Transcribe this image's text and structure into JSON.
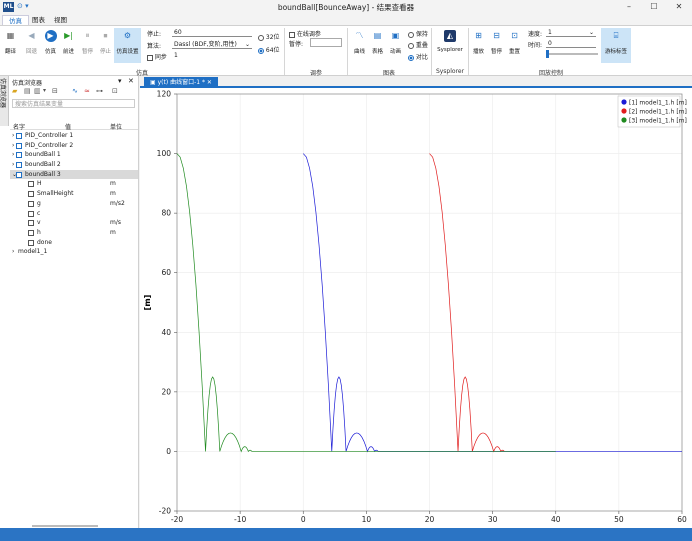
{
  "window": {
    "title": "boundBall[BounceAway] - 结果查看器",
    "app_icon": "ML",
    "quick_access": "⊙ ▾"
  },
  "menu": [
    "仿真",
    "图表",
    "视图"
  ],
  "ribbon": {
    "buttons_left": [
      {
        "label": "翻译",
        "icon": "translate-icon"
      },
      {
        "label": "回退",
        "icon": "step-back-icon"
      },
      {
        "label": "仿真",
        "icon": "play-icon"
      },
      {
        "label": "前进",
        "icon": "step-forward-icon"
      },
      {
        "label": "暂停",
        "icon": "pause-icon"
      },
      {
        "label": "停止",
        "icon": "stop-icon"
      },
      {
        "label": "仿真设置",
        "icon": "settings-icon"
      }
    ],
    "stop_label": "停止:",
    "stop_value": "60",
    "algo_label": "算法:",
    "algo_value": "Dassl (BDF,变阶,用性)",
    "sync_label": "同步",
    "sync_value": "1",
    "bit32": "32位",
    "bit64": "64位",
    "sim_group": "仿真",
    "online_label": "在线调参",
    "pause_label": "暂停:",
    "tune_group": "调参",
    "chart_buttons": [
      {
        "label": "曲线",
        "icon": "curve-icon"
      },
      {
        "label": "表格",
        "icon": "table-icon"
      },
      {
        "label": "动画",
        "icon": "animation-icon"
      }
    ],
    "keep": "保持",
    "overlay": "重叠",
    "compare": "对比",
    "chart_group": "图表",
    "sysplorer_label": "Sysplorer",
    "sysplorer_group": "Sysplorer",
    "play_buttons": [
      {
        "label": "播放",
        "icon": "play-record-icon"
      },
      {
        "label": "暂停",
        "icon": "pause-record-icon"
      },
      {
        "label": "重置",
        "icon": "reset-icon"
      }
    ],
    "speed_label": "速度:",
    "speed_value": "1",
    "time_label": "时间:",
    "time_value": "0",
    "cursor_button": "游标标签",
    "playback_group": "回放控制"
  },
  "browser": {
    "title": "仿真浏览器",
    "side_tab": "仿真浏览器",
    "search_placeholder": "搜索仿真结果变量",
    "columns": [
      "名字",
      "值",
      "单位"
    ],
    "rows": [
      {
        "name": "PID_Controller 1",
        "unit": "",
        "level": 0,
        "expander": "›"
      },
      {
        "name": "PID_Controller 2",
        "unit": "",
        "level": 0,
        "expander": "›"
      },
      {
        "name": "boundBall 1",
        "unit": "",
        "level": 0,
        "expander": "›"
      },
      {
        "name": "boundBall 2",
        "unit": "",
        "level": 0,
        "expander": "›"
      },
      {
        "name": "boundBall 3",
        "unit": "",
        "level": 0,
        "expander": "⌄",
        "selected": true
      },
      {
        "name": "H",
        "unit": "m",
        "level": 1
      },
      {
        "name": "SmallHeight",
        "unit": "m",
        "level": 1
      },
      {
        "name": "g",
        "unit": "m/s2",
        "level": 1
      },
      {
        "name": "c",
        "unit": "",
        "level": 1
      },
      {
        "name": "v",
        "unit": "m/s",
        "level": 1
      },
      {
        "name": "h",
        "unit": "m",
        "level": 1
      },
      {
        "name": "done",
        "unit": "",
        "level": 1
      },
      {
        "name": "model1_1",
        "unit": "",
        "level": 0,
        "expander": "›"
      }
    ]
  },
  "plot_tab": "y(t) 曲线窗口-1 *",
  "chart_data": {
    "type": "line",
    "ylabel": "[m]",
    "xlim": [
      -20,
      60
    ],
    "ylim": [
      -20,
      120
    ],
    "xticks": [
      -20,
      -10,
      0,
      10,
      20,
      30,
      40,
      50,
      60
    ],
    "yticks": [
      -20,
      0,
      20,
      40,
      60,
      80,
      100,
      120
    ],
    "legend_position": "top-right",
    "series": [
      {
        "name": "[1] model1_1.h [m]",
        "color": "#1a1ad6",
        "offset": 0
      },
      {
        "name": "[2] model1_1.h [m]",
        "color": "#e01c1c",
        "offset": 20
      },
      {
        "name": "[3] model1_1.h [m]",
        "color": "#1f8a1f",
        "offset": -20
      }
    ],
    "bounce_profile": {
      "drop": [
        [
          0,
          100
        ],
        [
          0.5,
          98.8
        ],
        [
          1,
          95.1
        ],
        [
          1.5,
          89.0
        ],
        [
          2,
          80.4
        ],
        [
          2.5,
          69.3
        ],
        [
          3,
          55.9
        ],
        [
          3.5,
          40.0
        ],
        [
          4,
          21.6
        ],
        [
          4.52,
          0
        ]
      ],
      "arcs": [
        [
          4.52,
          6.78,
          25
        ],
        [
          6.78,
          10.17,
          6.2
        ],
        [
          10.17,
          11.3,
          1.6
        ],
        [
          11.3,
          11.86,
          0.4
        ]
      ],
      "settle_end": 60
    }
  },
  "colors": {
    "accent": "#1f6fc4",
    "statusbar": "#2b74c4"
  }
}
